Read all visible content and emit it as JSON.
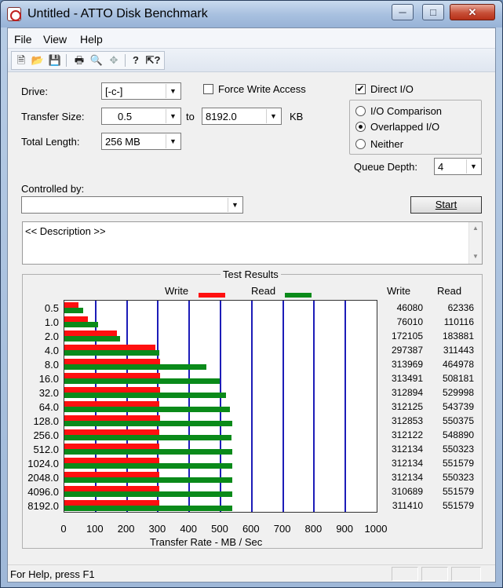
{
  "window": {
    "title": "Untitled - ATTO Disk Benchmark"
  },
  "menu": [
    "File",
    "View",
    "Help"
  ],
  "toolbar": {
    "icons": [
      "new-icon",
      "open-icon",
      "save-icon",
      "print-icon",
      "print-preview-icon",
      "move-icon",
      "help-icon",
      "context-help-icon"
    ]
  },
  "settings": {
    "drive_label": "Drive:",
    "drive_value": "[-c-]",
    "force_write_label": "Force Write Access",
    "force_write_checked": false,
    "direct_io_label": "Direct I/O",
    "direct_io_checked": true,
    "transfer_size_label": "Transfer Size:",
    "transfer_from": "0.5",
    "to_label": "to",
    "transfer_to": "8192.0",
    "kb_label": "KB",
    "total_length_label": "Total Length:",
    "total_length_value": "256 MB",
    "io_comparison_label": "I/O Comparison",
    "overlapped_io_label": "Overlapped I/O",
    "neither_label": "Neither",
    "selected_mode": "Overlapped I/O",
    "queue_depth_label": "Queue Depth:",
    "queue_depth_value": "4",
    "controlled_by_label": "Controlled by:",
    "controlled_by_value": "",
    "start_label": "Start",
    "description": "<< Description >>"
  },
  "results": {
    "title": "Test Results",
    "write_label": "Write",
    "read_label": "Read",
    "col_write": "Write",
    "col_read": "Read",
    "xlabel": "Transfer Rate - MB / Sec",
    "rows": [
      {
        "size": "0.5",
        "write": "46080",
        "read": "62336"
      },
      {
        "size": "1.0",
        "write": "76010",
        "read": "110116"
      },
      {
        "size": "2.0",
        "write": "172105",
        "read": "183881"
      },
      {
        "size": "4.0",
        "write": "297387",
        "read": "311443"
      },
      {
        "size": "8.0",
        "write": "313969",
        "read": "464978"
      },
      {
        "size": "16.0",
        "write": "313491",
        "read": "508181"
      },
      {
        "size": "32.0",
        "write": "312894",
        "read": "529998"
      },
      {
        "size": "64.0",
        "write": "312125",
        "read": "543739"
      },
      {
        "size": "128.0",
        "write": "312853",
        "read": "550375"
      },
      {
        "size": "256.0",
        "write": "312122",
        "read": "548890"
      },
      {
        "size": "512.0",
        "write": "312134",
        "read": "550323"
      },
      {
        "size": "1024.0",
        "write": "312134",
        "read": "551579"
      },
      {
        "size": "2048.0",
        "write": "312134",
        "read": "550323"
      },
      {
        "size": "4096.0",
        "write": "310689",
        "read": "551579"
      },
      {
        "size": "8192.0",
        "write": "311410",
        "read": "551579"
      }
    ]
  },
  "chart_data": {
    "type": "bar",
    "orientation": "horizontal",
    "categories": [
      "0.5",
      "1.0",
      "2.0",
      "4.0",
      "8.0",
      "16.0",
      "32.0",
      "64.0",
      "128.0",
      "256.0",
      "512.0",
      "1024.0",
      "2048.0",
      "4096.0",
      "8192.0"
    ],
    "series": [
      {
        "name": "Write",
        "color": "#ff1010",
        "values": [
          45,
          74.2,
          168.1,
          290.4,
          306.6,
          306.1,
          305.6,
          304.8,
          305.5,
          304.8,
          304.8,
          304.8,
          304.8,
          303.4,
          304.1
        ]
      },
      {
        "name": "Read",
        "color": "#0a8a1a",
        "values": [
          60.9,
          107.5,
          179.6,
          304.1,
          454.1,
          496.3,
          517.6,
          531.0,
          537.5,
          536.0,
          537.4,
          538.6,
          537.4,
          538.6,
          538.6
        ]
      }
    ],
    "xlim": [
      0,
      1000
    ],
    "xticks": [
      "0",
      "100",
      "200",
      "300",
      "400",
      "500",
      "600",
      "700",
      "800",
      "900",
      "1000"
    ],
    "xlabel": "Transfer Rate - MB / Sec",
    "title": "Test Results",
    "grid": true,
    "legend": "top"
  },
  "status": {
    "text": "For Help, press F1"
  }
}
